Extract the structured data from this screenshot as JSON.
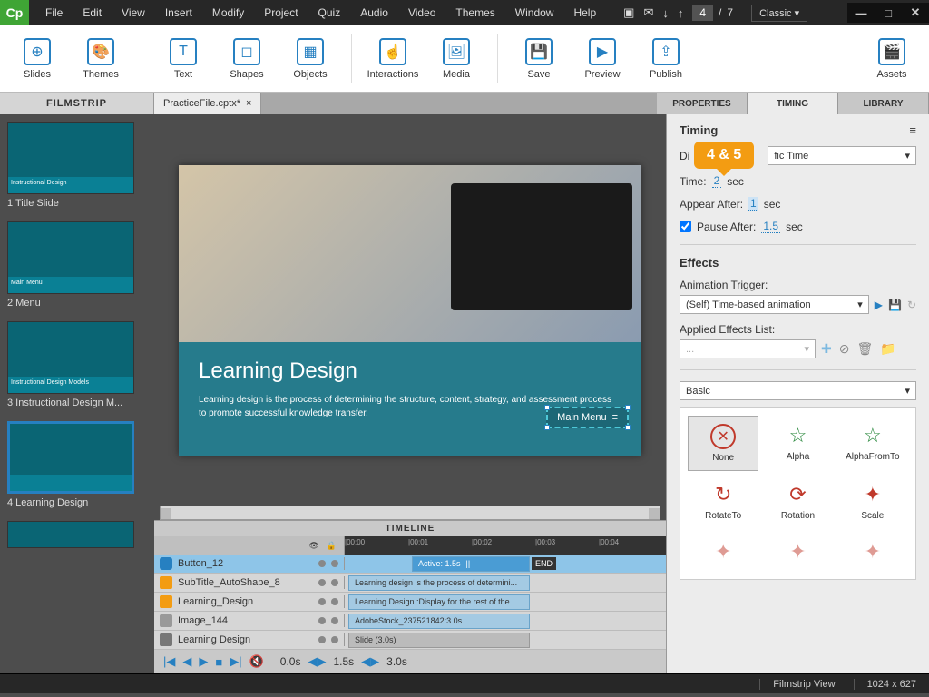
{
  "menubar": [
    "File",
    "Edit",
    "View",
    "Insert",
    "Modify",
    "Project",
    "Quiz",
    "Audio",
    "Video",
    "Themes",
    "Window",
    "Help"
  ],
  "page": {
    "current": "4",
    "total": "7"
  },
  "workspace": "Classic",
  "ribbon": [
    {
      "label": "Slides"
    },
    {
      "label": "Themes"
    },
    {
      "sep": true
    },
    {
      "label": "Text"
    },
    {
      "label": "Shapes"
    },
    {
      "label": "Objects"
    },
    {
      "sep": true
    },
    {
      "label": "Interactions"
    },
    {
      "label": "Media"
    },
    {
      "sep": true
    },
    {
      "label": "Save"
    },
    {
      "label": "Preview"
    },
    {
      "label": "Publish"
    },
    {
      "gap": true
    },
    {
      "label": "Assets"
    }
  ],
  "filmstrip_label": "FILMSTRIP",
  "file_tab": "PracticeFile.cptx*",
  "right_tabs": {
    "properties": "PROPERTIES",
    "timing": "TIMING",
    "library": "LIBRARY"
  },
  "slides": [
    {
      "n": "1",
      "name": "Title Slide",
      "title": "Instructional Design"
    },
    {
      "n": "2",
      "name": "Menu",
      "title": "Main Menu"
    },
    {
      "n": "3",
      "name": "Instructional Design M...",
      "title": "Instructional Design Models"
    },
    {
      "n": "4",
      "name": "Learning Design",
      "title": ""
    }
  ],
  "canvas": {
    "title": "Learning Design",
    "body": "Learning design is the process of determining the structure, content, strategy, and assessment process to promote successful knowledge transfer.",
    "menu_btn": "Main Menu"
  },
  "timeline": {
    "title": "TIMELINE",
    "ticks": [
      "00:00",
      "00:01",
      "00:02",
      "00:03",
      "00:04"
    ],
    "end": "END",
    "rows": [
      {
        "type": "btn",
        "name": "Button_12",
        "bar": "Active: 1.5s",
        "sel": true
      },
      {
        "type": "shape",
        "name": "SubTitle_AutoShape_8",
        "bar": "Learning design is the process of determini..."
      },
      {
        "type": "shape",
        "name": "Learning_Design",
        "bar": "Learning Design :Display for the rest of the ..."
      },
      {
        "type": "img",
        "name": "Image_144",
        "bar": "AdobeStock_237521842:3.0s"
      },
      {
        "type": "slide",
        "name": "Learning Design",
        "bar": "Slide (3.0s)"
      }
    ],
    "controls": {
      "time": "0.0s",
      "elapsed": "1.5s",
      "total": "3.0s"
    }
  },
  "timing_panel": {
    "header": "Timing",
    "display_label": "Display For:",
    "display_value": "Specific Time",
    "time_label": "Time:",
    "time_val": "2",
    "time_unit": "sec",
    "appear_label": "Appear After:",
    "appear_val": "1",
    "appear_unit": "sec",
    "pause_label": "Pause After:",
    "pause_val": "1.5",
    "pause_unit": "sec",
    "callout": "4 & 5"
  },
  "effects": {
    "header": "Effects",
    "trigger_label": "Animation Trigger:",
    "trigger_value": "(Self) Time-based animation",
    "applied_label": "Applied Effects List:",
    "applied_value": "...",
    "category": "Basic",
    "items": [
      "None",
      "Alpha",
      "AlphaFromTo",
      "RotateTo",
      "Rotation",
      "Scale"
    ]
  },
  "status": {
    "view": "Filmstrip View",
    "dims": "1024 x 627"
  }
}
